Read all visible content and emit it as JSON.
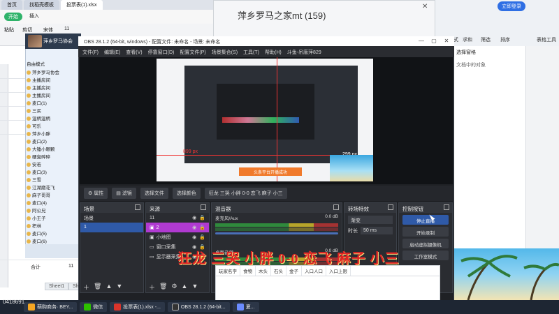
{
  "excel_tabs": [
    {
      "label": "首页"
    },
    {
      "label": "找稻壳模板"
    },
    {
      "label": "投票表(1).xlsx"
    }
  ],
  "excel_menu": {
    "new_label": "开始",
    "insert_label": "插入",
    "ribbon_font_size": "11",
    "ribbon_font_name": "宋体",
    "ribbon_paste_label": "粘贴",
    "ribbon_cut_label": "剪切"
  },
  "excel_left": {
    "sum_label": "合计",
    "sum_total": "11",
    "sheet_tab_1": "Sheet1",
    "sheet_tab_2": "Sh"
  },
  "group_window": {
    "title": "萍乡罗马之家mt (159)"
  },
  "wps": {
    "login_label": "立即登录",
    "ribbon_items": [
      "条件格式",
      "求和",
      "筛选",
      "排序",
      "填充",
      "单元格",
      "行和列",
      "工作表",
      "冻结",
      "表格工具"
    ],
    "pane_title": "选择窗格",
    "pane_text": "文档中的对象"
  },
  "qq": {
    "title": "萍乡罗马协会",
    "mode_label": "自由模式",
    "items": [
      {
        "label": "萍乡罗马协会"
      },
      {
        "label": "主播房间"
      },
      {
        "label": "主播房间"
      },
      {
        "label": "主播房间"
      },
      {
        "label": "麦口(1)"
      },
      {
        "label": "三买"
      },
      {
        "label": "溫柄溫柄"
      },
      {
        "label": "可乐"
      },
      {
        "label": "萍乡小胖"
      },
      {
        "label": "麦口(2)"
      },
      {
        "label": "大锤小颗颗"
      },
      {
        "label": "硬臭碎碎"
      },
      {
        "label": "安若"
      },
      {
        "label": "麦口(3)"
      },
      {
        "label": "三雪"
      },
      {
        "label": "江湖磨花飞"
      },
      {
        "label": "麻子哥哥"
      },
      {
        "label": "麦口(4)"
      },
      {
        "label": "阿公兄"
      },
      {
        "label": "小王子"
      },
      {
        "label": "积林"
      },
      {
        "label": "麦口(5)"
      },
      {
        "label": "麦口(6)"
      }
    ]
  },
  "obs": {
    "title": "OBS 28.1.2 (64-bit, windows) - 配置文件: 未命名 - 场景: 未命名",
    "menu": [
      "文件(F)",
      "编辑(E)",
      "查看(V)",
      "停靠窗口(D)",
      "配置文件(P)",
      "场景集合(S)",
      "工具(T)",
      "帮助(H)",
      "斗鱼-吊唐萍829"
    ],
    "preview": {
      "px_label_1": "899 px",
      "px_label_2": "299 px",
      "toast": "头条平台开播成功"
    },
    "source_bar": {
      "properties_label": "属性",
      "filters_label": "滤镜",
      "select_file_label": "选择文件",
      "select_color_label": "选择颜色",
      "ticker_text": "狂龙 三哭 小胖 0-0 恋飞 麻子 小三"
    },
    "scenes": {
      "title": "场景",
      "items": [
        {
          "label": "场景"
        },
        {
          "label": "1"
        }
      ]
    },
    "sources": {
      "title": "来源",
      "items": [
        {
          "label": "11"
        },
        {
          "label": "2"
        },
        {
          "label": "小地图"
        },
        {
          "label": "窗口采集"
        },
        {
          "label": "显示器采集"
        }
      ]
    },
    "mixer": {
      "title": "混音器",
      "channels": [
        {
          "name": "麦克风/Aux",
          "db": "0.0 dB"
        },
        {
          "name": "桌面音频",
          "db": "0.0 dB"
        }
      ]
    },
    "transitions": {
      "title": "转场特效",
      "selected": "渐变",
      "duration_label": "时长",
      "duration_value": "50 ms"
    },
    "controls": {
      "title": "控制按钮",
      "stop_stream": "停止直播",
      "start_record": "开始录制",
      "start_virtual_cam": "启动虚拟摄像机",
      "studio_mode": "工作室模式"
    }
  },
  "overlay_text": "狂龙 三哭 小胖 0-0 恋飞 麻子 小三",
  "sheet2": {
    "headers": [
      "玩家名字",
      "食物",
      "木头",
      "石头",
      "金子",
      "入口人口",
      "入口上限"
    ]
  },
  "taskbar": {
    "clock": "0418691",
    "items": [
      {
        "label": "萌购商务· BEY..."
      },
      {
        "label": "微信"
      },
      {
        "label": "投票表(1).xlsx -..."
      },
      {
        "label": "OBS 28.1.2 (64-bit..."
      },
      {
        "label": "夏..."
      }
    ]
  },
  "colors": {
    "obs_selection": "#2f5aa8",
    "source_selection": "#b03ad1",
    "overlay_red": "#e02424",
    "wps_blue": "#2f6fe4"
  }
}
